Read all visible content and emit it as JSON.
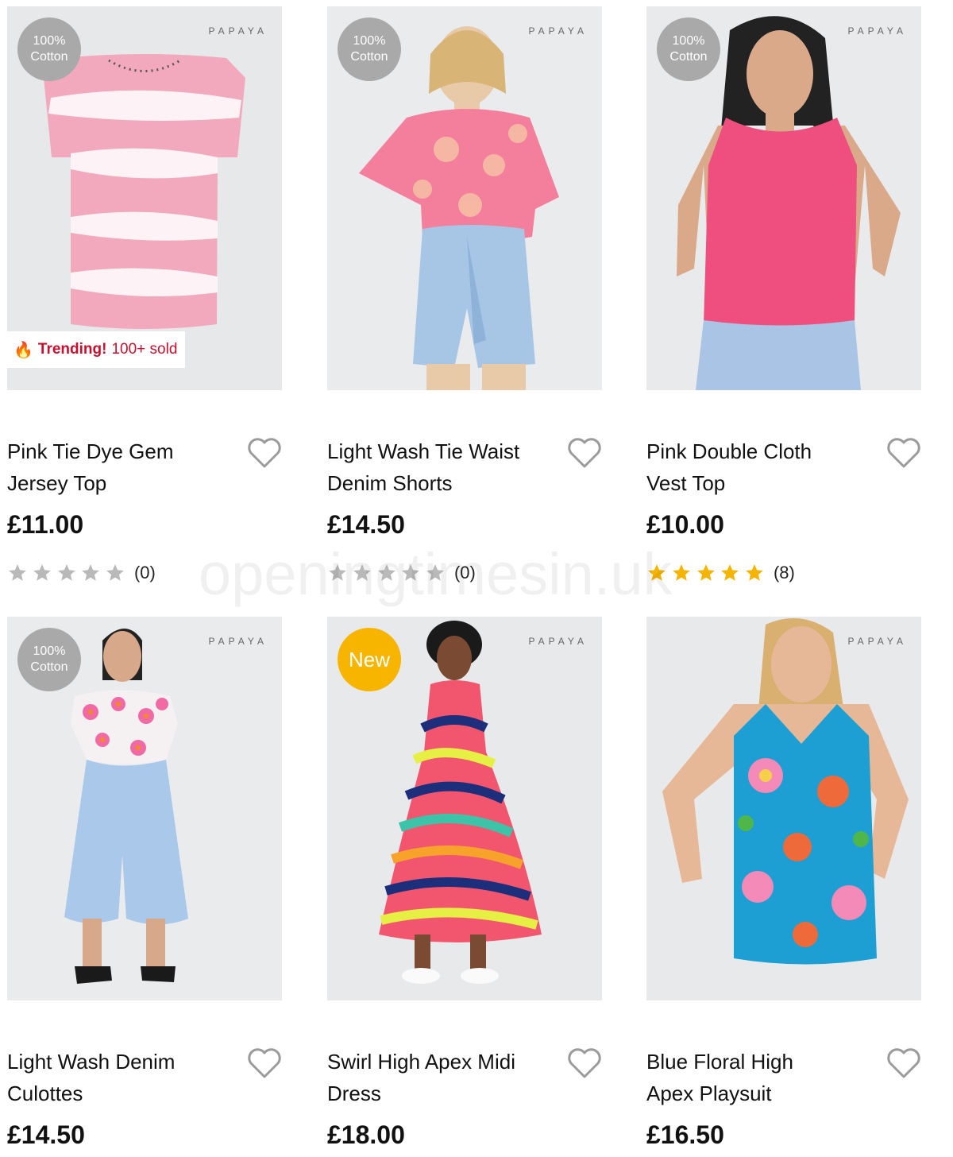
{
  "products": [
    {
      "brand": "PAPAYA",
      "badge_line1": "100%",
      "badge_line2": "Cotton",
      "trending_label": "Trending!",
      "trending_sold": "100+ sold",
      "name_line1": "Pink Tie Dye Gem",
      "name_line2": "Jersey Top",
      "price": "£11.00",
      "rating_stars": 0,
      "review_count": "(0)",
      "image_colors": {
        "bg": "#e7e8ea",
        "primary": "#f2a9bd",
        "secondary": "#ffffff"
      }
    },
    {
      "brand": "PAPAYA",
      "badge_line1": "100%",
      "badge_line2": "Cotton",
      "name_line1": "Light Wash Tie Waist",
      "name_line2": "Denim Shorts",
      "price": "£14.50",
      "rating_stars": 0,
      "review_count": "(0)",
      "image_colors": {
        "bg": "#eaebed",
        "primary": "#f47f9c",
        "secondary": "#a7c6e6"
      }
    },
    {
      "brand": "PAPAYA",
      "badge_line1": "100%",
      "badge_line2": "Cotton",
      "name_line1": "Pink Double Cloth",
      "name_line2": "Vest Top",
      "price": "£10.00",
      "rating_stars": 5,
      "review_count": "(8)",
      "image_colors": {
        "bg": "#e9eaec",
        "primary": "#ef4f7e",
        "secondary": "#a9c4e4"
      }
    },
    {
      "brand": "PAPAYA",
      "badge_line1": "100%",
      "badge_line2": "Cotton",
      "name_line1": "Light Wash Denim",
      "name_line2": "Culottes",
      "price": "£14.50",
      "image_colors": {
        "bg": "#eaebed",
        "primary": "#f16aa4",
        "secondary": "#a9c8ea"
      }
    },
    {
      "brand": "PAPAYA",
      "badge_new": "New",
      "name_line1": "Swirl High Apex Midi",
      "name_line2": "Dress",
      "price": "£18.00",
      "image_colors": {
        "bg": "#e8e9eb",
        "primary": "#f2566e",
        "secondary": "#1d2e7a"
      }
    },
    {
      "brand": "PAPAYA",
      "name_line1": "Blue Floral High",
      "name_line2": "Apex Playsuit",
      "price": "£16.50",
      "image_colors": {
        "bg": "#e8e9eb",
        "primary": "#1d9fd3",
        "secondary": "#ee6a3a"
      }
    }
  ],
  "colors": {
    "star_filled": "#f4b400",
    "star_empty": "#b9b9b9",
    "heart_outline": "#9b9b9b",
    "trending_red": "#c8102e",
    "badge_grey": "#a9a9a9",
    "badge_new": "#f7b500"
  },
  "icons": {
    "wishlist": "heart-outline-icon",
    "rating": "star-icon",
    "trending": "flame-icon"
  },
  "watermark": "openingtimesin.uk"
}
